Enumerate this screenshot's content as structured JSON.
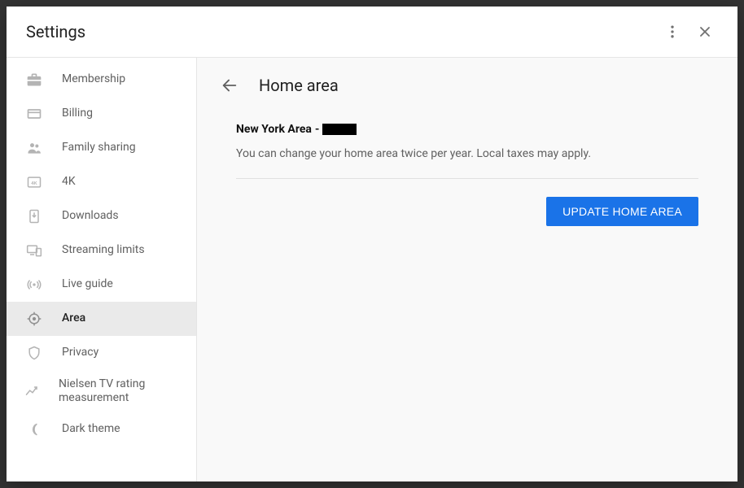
{
  "title": "Settings",
  "sidebar": {
    "items": [
      {
        "label": "Membership",
        "icon": "briefcase-icon"
      },
      {
        "label": "Billing",
        "icon": "card-icon"
      },
      {
        "label": "Family sharing",
        "icon": "people-icon"
      },
      {
        "label": "4K",
        "icon": "fourk-icon"
      },
      {
        "label": "Downloads",
        "icon": "download-icon"
      },
      {
        "label": "Streaming limits",
        "icon": "devices-icon"
      },
      {
        "label": "Live guide",
        "icon": "broadcast-icon"
      },
      {
        "label": "Area",
        "icon": "target-icon"
      },
      {
        "label": "Privacy",
        "icon": "shield-icon"
      },
      {
        "label": "Nielsen TV rating measurement",
        "icon": "trend-icon"
      },
      {
        "label": "Dark theme",
        "icon": "moon-icon"
      }
    ],
    "selected_index": 7
  },
  "content": {
    "heading": "Home area",
    "current_area_prefix": "New York Area",
    "current_area_sep": "-",
    "current_area_value_redacted": true,
    "help_text": "You can change your home area twice per year. Local taxes may apply.",
    "primary_button_label": "Update Home Area"
  }
}
